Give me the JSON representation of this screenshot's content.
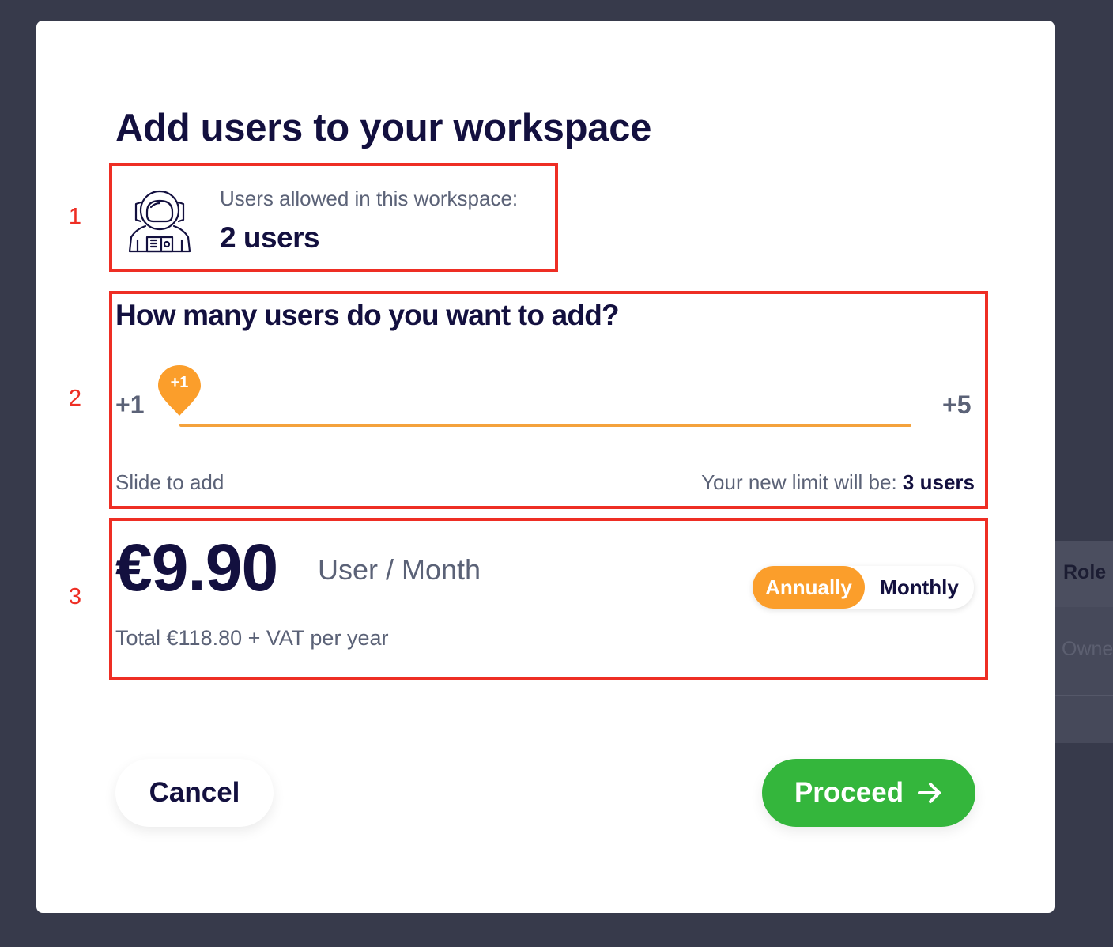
{
  "background": {
    "table_header": "Role",
    "table_cell": "Owner"
  },
  "modal": {
    "title": "Add users to your workspace"
  },
  "annotations": [
    "1",
    "2",
    "3"
  ],
  "workspace_limit": {
    "icon": "astronaut-icon",
    "label": "Users allowed in this workspace:",
    "value": "2 users"
  },
  "add_users": {
    "question": "How many users do you want to add?",
    "slider": {
      "min_label": "+1",
      "max_label": "+5",
      "current_label": "+1",
      "min": 1,
      "max": 5,
      "value": 1
    },
    "hint": "Slide to add",
    "new_limit_label": "Your new limit will be:",
    "new_limit_value": "3 users"
  },
  "pricing": {
    "price": "€9.90",
    "unit": "User / Month",
    "total": "Total €118.80 + VAT per year",
    "billing_toggle": {
      "options": [
        "Annually",
        "Monthly"
      ],
      "selected": "Annually"
    }
  },
  "footer": {
    "cancel_label": "Cancel",
    "proceed_label": "Proceed",
    "proceed_icon": "arrow-right-icon"
  },
  "colors": {
    "accent_orange": "#fb9e2b",
    "proceed_green": "#34b63c",
    "title_navy": "#13103f",
    "annotation_red": "#ee2e24",
    "overlay": "#373a4b"
  }
}
